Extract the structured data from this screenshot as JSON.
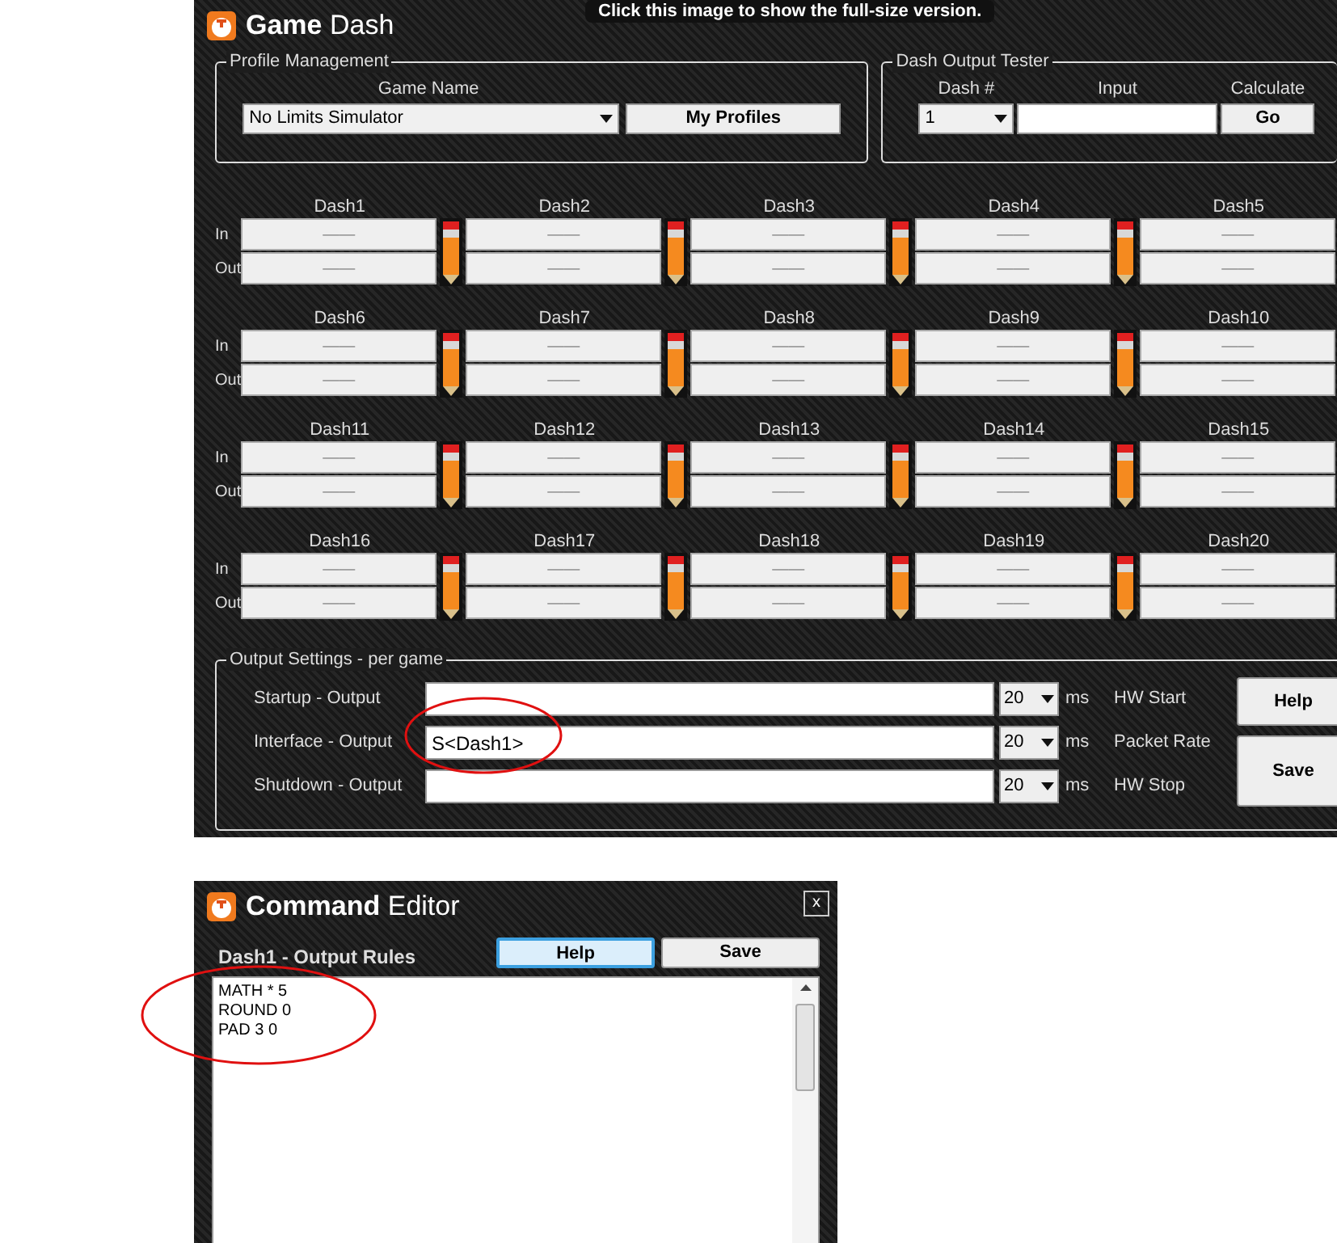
{
  "main_window": {
    "title_bold": "Game",
    "title_rest": "Dash"
  },
  "tooltip": "Click this image to show the full-size version.",
  "profile_management": {
    "legend": "Profile Management",
    "game_name_label": "Game Name",
    "game_name_value": "No Limits Simulator",
    "my_profiles_button": "My Profiles"
  },
  "dash_output_tester": {
    "legend": "Dash Output Tester",
    "dash_label": "Dash #",
    "dash_value": "1",
    "input_label": "Input",
    "calculate_label": "Calculate",
    "go_button": "Go"
  },
  "dash_groups": [
    {
      "in_label": "In",
      "out_label": "Out",
      "dashes": [
        {
          "name": "Dash1",
          "in": "——",
          "out": "——"
        },
        {
          "name": "Dash2",
          "in": "——",
          "out": "——"
        },
        {
          "name": "Dash3",
          "in": "——",
          "out": "——"
        },
        {
          "name": "Dash4",
          "in": "——",
          "out": "——"
        },
        {
          "name": "Dash5",
          "in": "——",
          "out": "——"
        }
      ]
    },
    {
      "in_label": "In",
      "out_label": "Out",
      "dashes": [
        {
          "name": "Dash6",
          "in": "——",
          "out": "——"
        },
        {
          "name": "Dash7",
          "in": "——",
          "out": "——"
        },
        {
          "name": "Dash8",
          "in": "——",
          "out": "——"
        },
        {
          "name": "Dash9",
          "in": "——",
          "out": "——"
        },
        {
          "name": "Dash10",
          "in": "——",
          "out": "——"
        }
      ]
    },
    {
      "in_label": "In",
      "out_label": "Out",
      "dashes": [
        {
          "name": "Dash11",
          "in": "——",
          "out": "——"
        },
        {
          "name": "Dash12",
          "in": "——",
          "out": "——"
        },
        {
          "name": "Dash13",
          "in": "——",
          "out": "——"
        },
        {
          "name": "Dash14",
          "in": "——",
          "out": "——"
        },
        {
          "name": "Dash15",
          "in": "——",
          "out": "——"
        }
      ]
    },
    {
      "in_label": "In",
      "out_label": "Out",
      "dashes": [
        {
          "name": "Dash16",
          "in": "——",
          "out": "——"
        },
        {
          "name": "Dash17",
          "in": "——",
          "out": "——"
        },
        {
          "name": "Dash18",
          "in": "——",
          "out": "——"
        },
        {
          "name": "Dash19",
          "in": "——",
          "out": "——"
        },
        {
          "name": "Dash20",
          "in": "——",
          "out": "——"
        }
      ]
    }
  ],
  "output_settings": {
    "legend": "Output Settings - per game",
    "rows": [
      {
        "label": "Startup - Output",
        "value": "",
        "interval": "20",
        "unit": "ms",
        "note": "HW Start"
      },
      {
        "label": "Interface - Output",
        "value": "S<Dash1>",
        "interval": "20",
        "unit": "ms",
        "note": "Packet Rate"
      },
      {
        "label": "Shutdown - Output",
        "value": "",
        "interval": "20",
        "unit": "ms",
        "note": "HW Stop"
      }
    ],
    "help_button": "Help",
    "save_button": "Save"
  },
  "command_editor": {
    "title_bold": "Command",
    "title_rest": "Editor",
    "close": "x",
    "subtitle": "Dash1 - Output Rules",
    "buttons": [
      {
        "label": "Help",
        "focused": true
      },
      {
        "label": "Save",
        "focused": false
      }
    ],
    "lines": [
      "MATH * 5",
      "ROUND 0",
      "PAD 3 0"
    ]
  }
}
